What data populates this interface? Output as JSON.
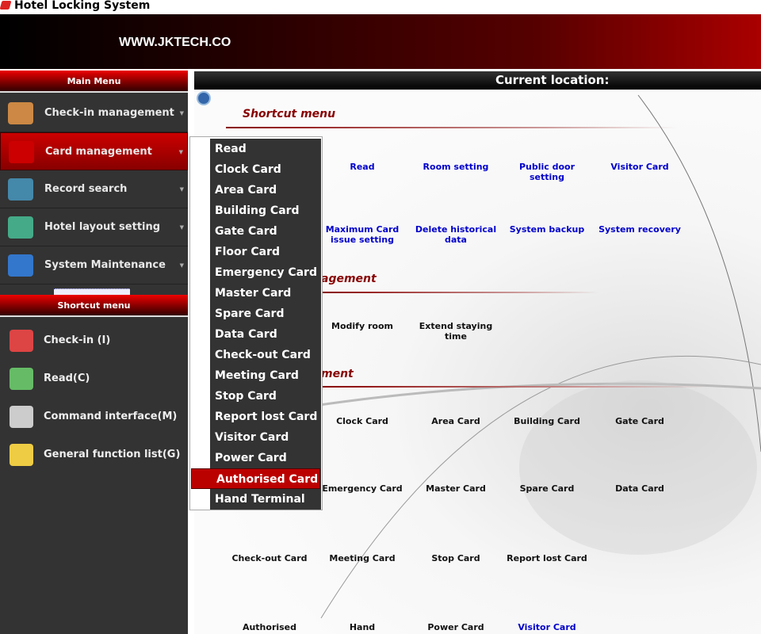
{
  "window": {
    "title": "Hotel Locking System"
  },
  "banner": {
    "text": "WWW.JKTECH.CO"
  },
  "main_menu": {
    "title": "Main Menu",
    "items": [
      {
        "label": "Check-in management",
        "icon": "door-arrow-icon"
      },
      {
        "label": "Card management",
        "icon": "card-icon",
        "active": true
      },
      {
        "label": "Record search",
        "icon": "magnifier-icon"
      },
      {
        "label": "Hotel layout setting",
        "icon": "building-icon"
      },
      {
        "label": "System Maintenance",
        "icon": "tools-icon"
      }
    ]
  },
  "shortcut_sidebar": {
    "title": "Shortcut menu",
    "items": [
      {
        "label": "Check-in (I)",
        "icon": "hand-card-icon"
      },
      {
        "label": "Read(C)",
        "icon": "recycle-bin-icon"
      },
      {
        "label": "Command interface(M)",
        "icon": "plug-check-icon"
      },
      {
        "label": "General function list(G)",
        "icon": "function-list-icon"
      }
    ]
  },
  "location": {
    "label": "Current location:"
  },
  "sections": {
    "shortcut": {
      "title": "Shortcut menu",
      "rows": [
        [
          "Read",
          "Room setting",
          "Public door setting",
          "Visitor Card"
        ],
        [
          "Maximum Card issue setting",
          "Delete historical data",
          "System backup",
          "System recovery"
        ]
      ]
    },
    "room": {
      "title": "agement",
      "rows": [
        [
          "Modify room",
          "Extend staying time"
        ]
      ]
    },
    "card": {
      "title": "ment",
      "rows": [
        [
          "Clock Card",
          "Area Card",
          "Building Card",
          "Gate Card"
        ],
        [
          "Emergency Card",
          "Master Card",
          "Spare Card",
          "Data Card"
        ],
        [
          "Check-out Card",
          "Meeting Card",
          "Stop Card",
          "Report lost Card"
        ],
        [
          "Authorised",
          "Hand",
          "Power Card",
          "Visitor Card"
        ]
      ]
    }
  },
  "popup_menu": {
    "items": [
      "Read",
      "Clock Card",
      "Area Card",
      "Building Card",
      "Gate Card",
      "Floor Card",
      "Emergency Card",
      "Master Card",
      "Spare Card",
      "Data Card",
      "Check-out Card",
      "Meeting Card",
      "Stop Card",
      "Report lost Card",
      "Visitor Card",
      "Power Card",
      "Authorised Card",
      "Hand Terminal"
    ],
    "selected": "Authorised Card"
  },
  "colors": {
    "accent": "#b00000",
    "link": "#0000cc",
    "sidebar": "#333333"
  }
}
